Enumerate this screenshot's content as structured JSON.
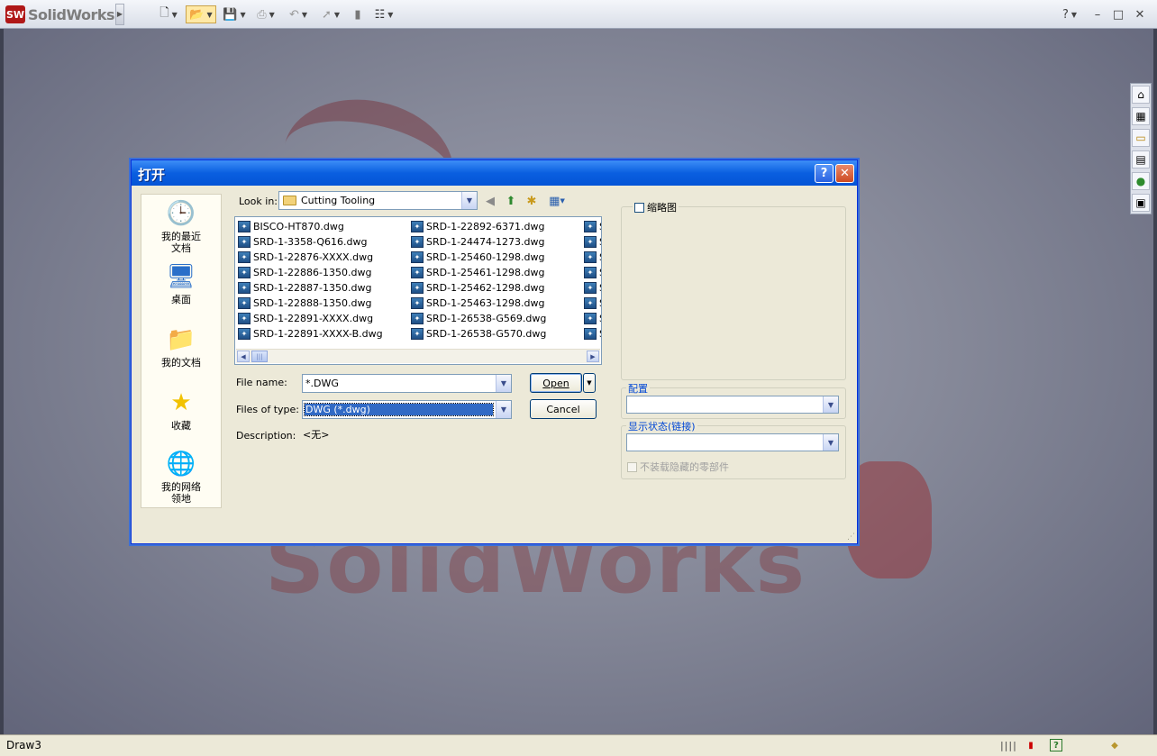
{
  "app": {
    "logo_mark": "SW",
    "logo_text": "SolidWorks",
    "window_controls": [
      "?",
      "–",
      "□",
      "✕"
    ]
  },
  "statusbar": {
    "text": "Draw3",
    "help_glyph": "?"
  },
  "dialog": {
    "title": "打开",
    "help_glyph": "?",
    "close_glyph": "✕",
    "places": [
      {
        "label": "我的最近\n文档",
        "icon": "recent-documents-icon"
      },
      {
        "label": "桌面",
        "icon": "desktop-icon"
      },
      {
        "label": "我的文档",
        "icon": "my-documents-icon"
      },
      {
        "label": "收藏",
        "icon": "favorites-star-icon"
      },
      {
        "label": "我的网络\n领地",
        "icon": "network-places-icon"
      }
    ],
    "look_in_label": "Look in:",
    "look_in_value": "Cutting Tooling",
    "files": {
      "col1": [
        "BISCO-HT870.dwg",
        "SRD-1-3358-Q616.dwg",
        "SRD-1-22876-XXXX.dwg",
        "SRD-1-22886-1350.dwg",
        "SRD-1-22887-1350.dwg",
        "SRD-1-22888-1350.dwg",
        "SRD-1-22891-XXXX.dwg",
        "SRD-1-22891-XXXX-B.dwg"
      ],
      "col2": [
        "SRD-1-22892-6371.dwg",
        "SRD-1-24474-1273.dwg",
        "SRD-1-25460-1298.dwg",
        "SRD-1-25461-1298.dwg",
        "SRD-1-25462-1298.dwg",
        "SRD-1-25463-1298.dwg",
        "SRD-1-26538-G569.dwg",
        "SRD-1-26538-G570.dwg"
      ],
      "col3": [
        "S",
        "S",
        "S",
        "S",
        "S",
        "S",
        "S",
        "S"
      ]
    },
    "file_name_label": "File name:",
    "file_name_value": "*.DWG",
    "files_of_type_label": "Files of type:",
    "files_of_type_value": "DWG (*.dwg)",
    "description_label": "Description:",
    "description_value": "<无>",
    "open_button": "Open",
    "cancel_button": "Cancel",
    "thumbnail_label": "缩略图",
    "config_label": "配置",
    "display_state_label": "显示状态(链接)",
    "hide_components_label": "不装载隐藏的零部件"
  }
}
